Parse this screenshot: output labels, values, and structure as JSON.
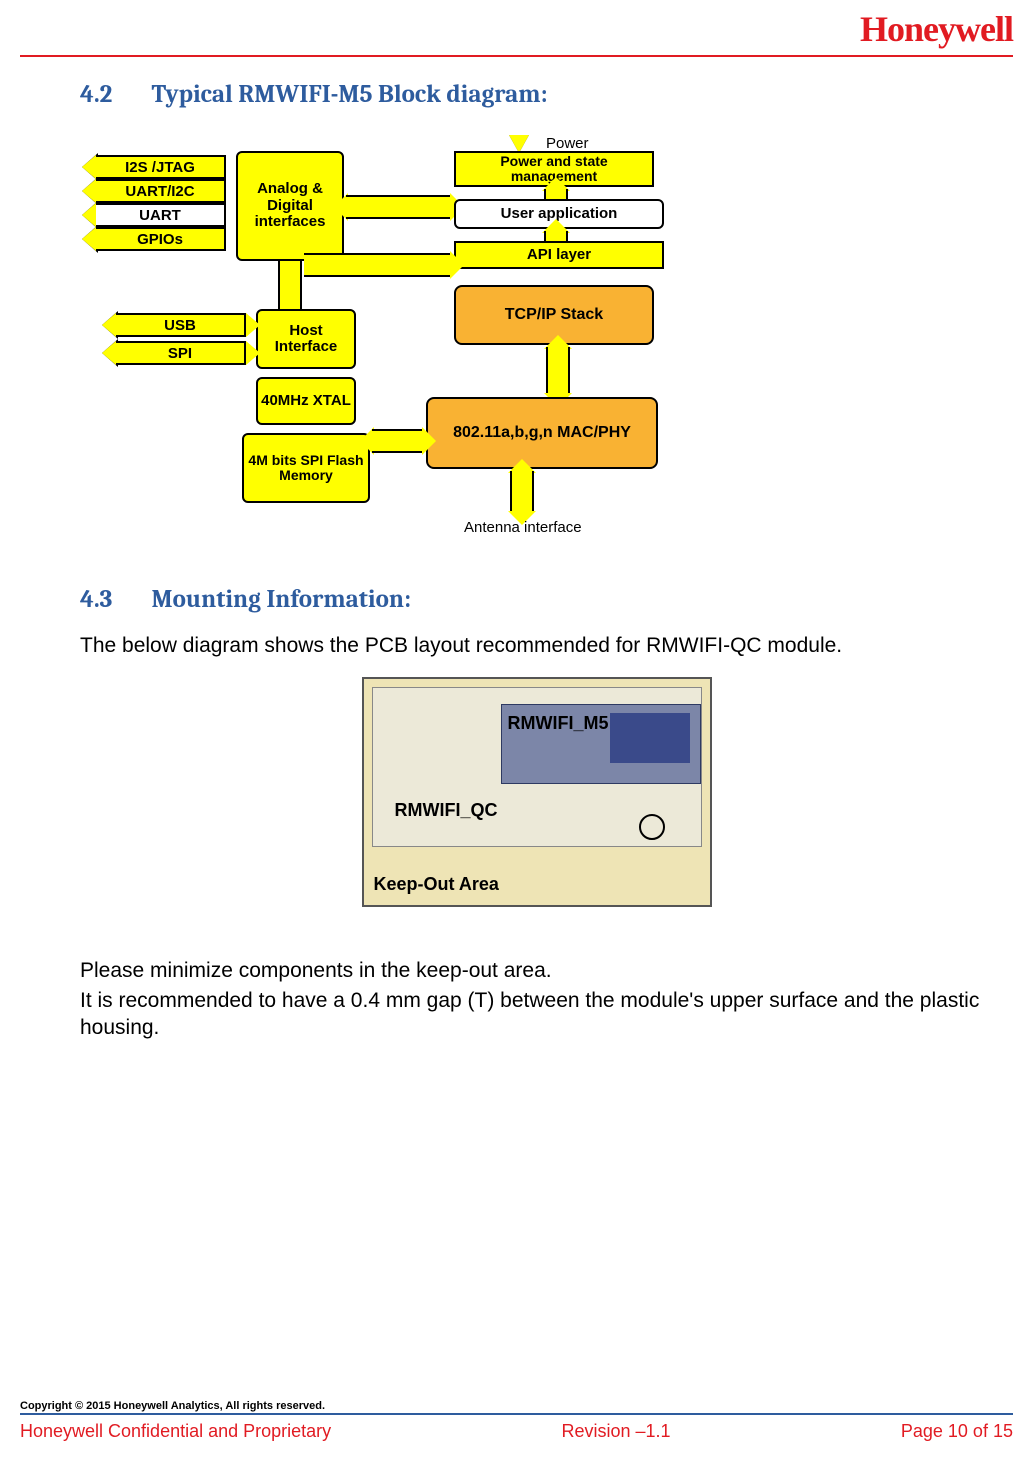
{
  "brand": "Honeywell",
  "sections": {
    "s42": {
      "num": "4.2",
      "title": "Typical RMWIFI-M5 Block diagram:"
    },
    "s43": {
      "num": "4.3",
      "title": "Mounting Information:"
    }
  },
  "body": {
    "p1": "The below diagram shows the PCB layout recommended for RMWIFI-QC module.",
    "p2": "Please minimize components in the keep-out area.",
    "p3": "It is recommended to have a 0.4 mm gap (T) between the module's upper surface and the plastic housing."
  },
  "diagram": {
    "power_label": "Power",
    "power_state": "Power and state management",
    "analog_digital": "Analog & Digital interfaces",
    "user_app": "User application",
    "api_layer": "API layer",
    "tcpip": "TCP/IP Stack",
    "host_if": "Host Interface",
    "xtal": "40MHz XTAL",
    "flash": "4M bits SPI Flash Memory",
    "mac_phy": "802.11a,b,g,n MAC/PHY",
    "antenna": "Antenna interface",
    "side": {
      "i2s": "I2S /JTAG",
      "uart_i2c": "UART/I2C",
      "uart": "UART",
      "gpios": "GPIOs",
      "usb": "USB",
      "spi": "SPI"
    }
  },
  "mount": {
    "m5": "RMWIFI_M5",
    "qc": "RMWIFI_QC",
    "keep": "Keep-Out Area"
  },
  "footer": {
    "copyright": "Copyright © 2015 Honeywell Analytics, All rights reserved.",
    "left": "Honeywell Confidential and Proprietary",
    "center": "Revision –1.1",
    "right": "Page 10 of 15"
  }
}
